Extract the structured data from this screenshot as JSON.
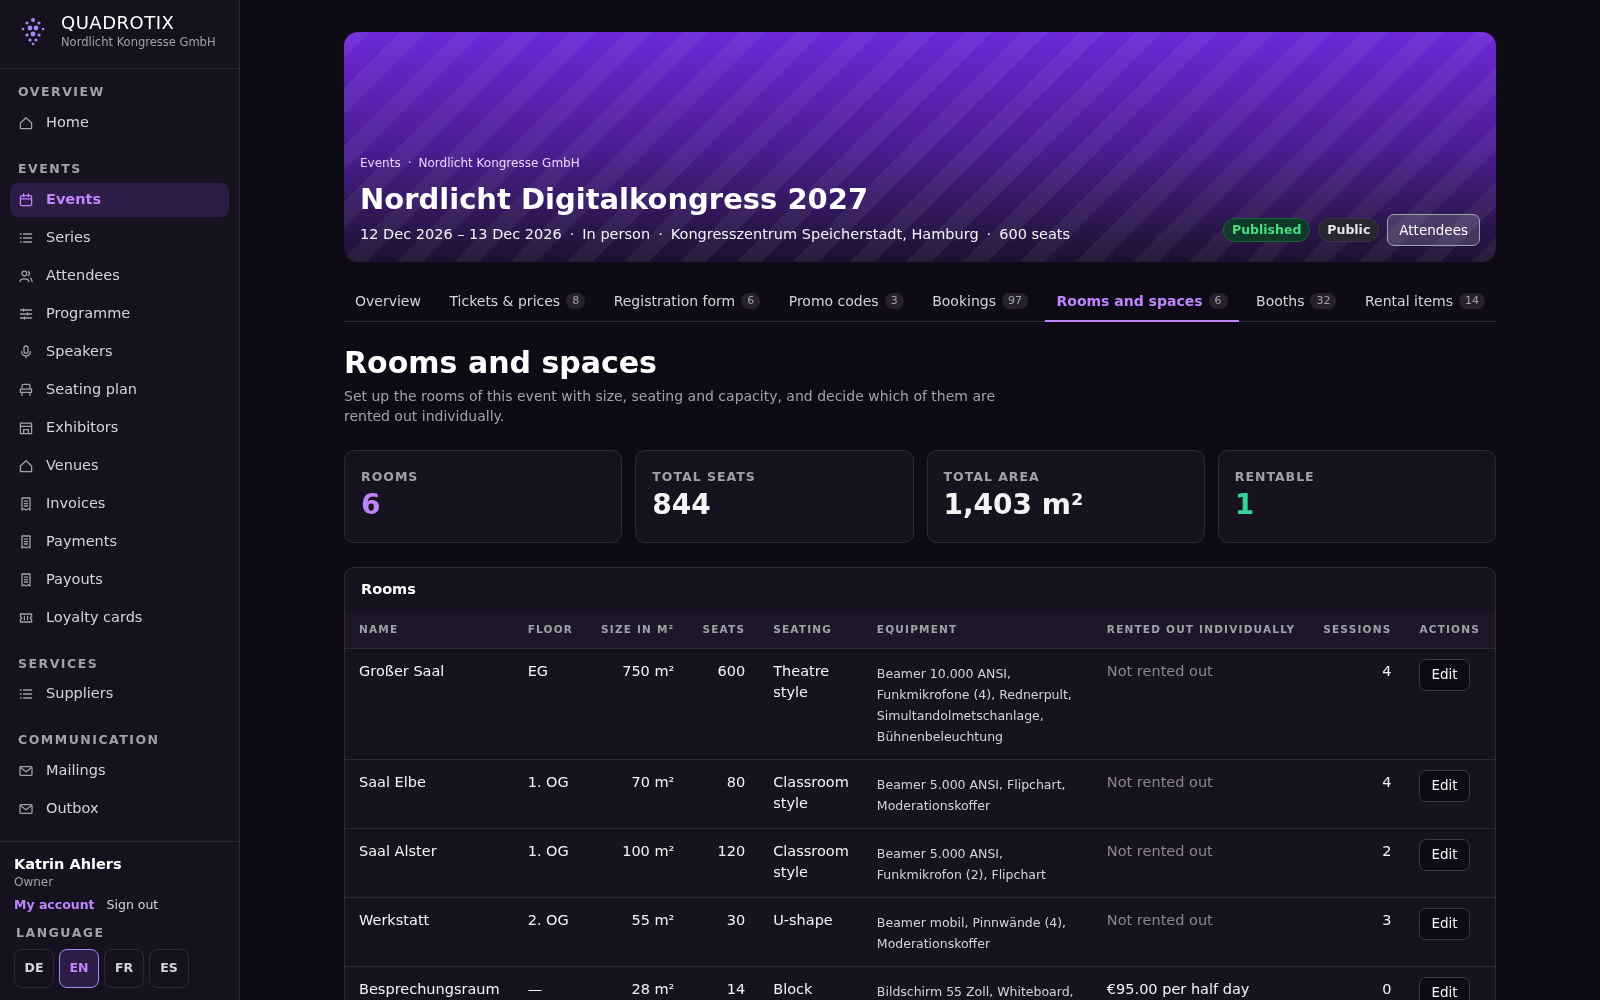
{
  "brand": {
    "name": "QUADROTIX",
    "org": "Nordlicht Kongresse GmbH"
  },
  "sidebar": {
    "sections": [
      {
        "title": "OVERVIEW",
        "items": [
          {
            "label": "Home",
            "kind": "home",
            "selected": false
          }
        ]
      },
      {
        "title": "EVENTS",
        "items": [
          {
            "label": "Events",
            "kind": "calendar",
            "selected": true
          },
          {
            "label": "Series",
            "kind": "list",
            "selected": false
          },
          {
            "label": "Attendees",
            "kind": "people",
            "selected": false
          },
          {
            "label": "Programme",
            "kind": "sliders",
            "selected": false
          },
          {
            "label": "Speakers",
            "kind": "mic",
            "selected": false
          },
          {
            "label": "Seating plan",
            "kind": "seat",
            "selected": false
          },
          {
            "label": "Exhibitors",
            "kind": "store",
            "selected": false
          },
          {
            "label": "Venues",
            "kind": "home",
            "selected": false
          },
          {
            "label": "Invoices",
            "kind": "receipt",
            "selected": false
          },
          {
            "label": "Payments",
            "kind": "receipt",
            "selected": false
          },
          {
            "label": "Payouts",
            "kind": "receipt",
            "selected": false
          },
          {
            "label": "Loyalty cards",
            "kind": "ticket",
            "selected": false
          }
        ]
      },
      {
        "title": "SERVICES",
        "items": [
          {
            "label": "Suppliers",
            "kind": "list",
            "selected": false
          }
        ]
      },
      {
        "title": "COMMUNICATION",
        "items": [
          {
            "label": "Mailings",
            "kind": "mail",
            "selected": false
          },
          {
            "label": "Outbox",
            "kind": "mail",
            "selected": false
          }
        ]
      }
    ],
    "user": {
      "name": "Katrin Ahlers",
      "role": "Owner",
      "account_link": "My account",
      "sign_out": "Sign out"
    },
    "language": {
      "title": "LANGUAGE",
      "options": [
        {
          "label": "DE",
          "selected": false
        },
        {
          "label": "EN",
          "selected": true
        },
        {
          "label": "FR",
          "selected": false
        },
        {
          "label": "ES",
          "selected": false
        }
      ]
    }
  },
  "hero": {
    "separator": "·",
    "breadcrumb": [
      "Events",
      "Nordlicht Kongresse GmbH"
    ],
    "title": "Nordlicht Digitalkongress 2027",
    "meta": [
      "12 Dec 2026 – 13 Dec 2026",
      "In person",
      "Kongresszentrum Speicherstadt, Hamburg",
      "600 seats"
    ],
    "badges": [
      {
        "label": "Published",
        "kind": "success"
      },
      {
        "label": "Public",
        "kind": "neutral"
      }
    ],
    "button": "Attendees"
  },
  "tabs": [
    {
      "label": "Overview",
      "selected": false
    },
    {
      "label": "Tickets & prices",
      "count": "8",
      "selected": false
    },
    {
      "label": "Registration form",
      "count": "6",
      "selected": false
    },
    {
      "label": "Promo codes",
      "count": "3",
      "selected": false
    },
    {
      "label": "Bookings",
      "count": "97",
      "selected": false
    },
    {
      "label": "Rooms and spaces",
      "count": "6",
      "selected": true
    },
    {
      "label": "Booths",
      "count": "32",
      "selected": false
    },
    {
      "label": "Rental items",
      "count": "14",
      "selected": false
    }
  ],
  "page": {
    "title": "Rooms and spaces",
    "description": "Set up the rooms of this event with size, seating and capacity, and decide which of them are rented out individually."
  },
  "stats": [
    {
      "label": "ROOMS",
      "value": "6",
      "color": "#c084fc"
    },
    {
      "label": "TOTAL SEATS",
      "value": "844",
      "color": "#f4f4f5"
    },
    {
      "label": "TOTAL AREA",
      "value": "1,403 m²",
      "color": "#f4f4f5"
    },
    {
      "label": "RENTABLE",
      "value": "1",
      "color": "#34d399"
    }
  ],
  "table": {
    "title": "Rooms",
    "columns": [
      "NAME",
      "FLOOR",
      "SIZE IN M²",
      "SEATS",
      "SEATING",
      "EQUIPMENT",
      "RENTED OUT INDIVIDUALLY",
      "SESSIONS",
      "ACTIONS"
    ],
    "rows": [
      {
        "name": "Großer Saal",
        "floor": "EG",
        "size": "750 m²",
        "seats": "600",
        "seating": "Theatre style",
        "equipment": "Beamer 10.000 ANSI, Funkmikrofone (4), Rednerpult, Simultandolmetschanlage, Bühnenbeleuchtung",
        "rented_out": false,
        "rental": "Not rented out",
        "sessions": "4",
        "action": "Edit"
      },
      {
        "name": "Saal Elbe",
        "floor": "1. OG",
        "size": "70 m²",
        "seats": "80",
        "seating": "Classroom style",
        "equipment": "Beamer 5.000 ANSI, Flipchart, Moderationskoffer",
        "rented_out": false,
        "rental": "Not rented out",
        "sessions": "4",
        "action": "Edit"
      },
      {
        "name": "Saal Alster",
        "floor": "1. OG",
        "size": "100 m²",
        "seats": "120",
        "seating": "Classroom style",
        "equipment": "Beamer 5.000 ANSI, Funkmikrofon (2), Flipchart",
        "rented_out": false,
        "rental": "Not rented out",
        "sessions": "2",
        "action": "Edit"
      },
      {
        "name": "Werkstatt",
        "floor": "2. OG",
        "size": "55 m²",
        "seats": "30",
        "seating": "U-shape",
        "equipment": "Beamer mobil, Pinnwände (4), Moderationskoffer",
        "rented_out": false,
        "rental": "Not rented out",
        "sessions": "3",
        "action": "Edit"
      },
      {
        "name": "Besprechungsraum",
        "floor": "—",
        "size": "28 m²",
        "seats": "14",
        "seating": "Block",
        "equipment": "Bildschirm 55 Zoll, Whiteboard,",
        "rented_out": true,
        "rental": "€95.00 per half day",
        "sessions": "0",
        "action": "Edit"
      }
    ]
  }
}
